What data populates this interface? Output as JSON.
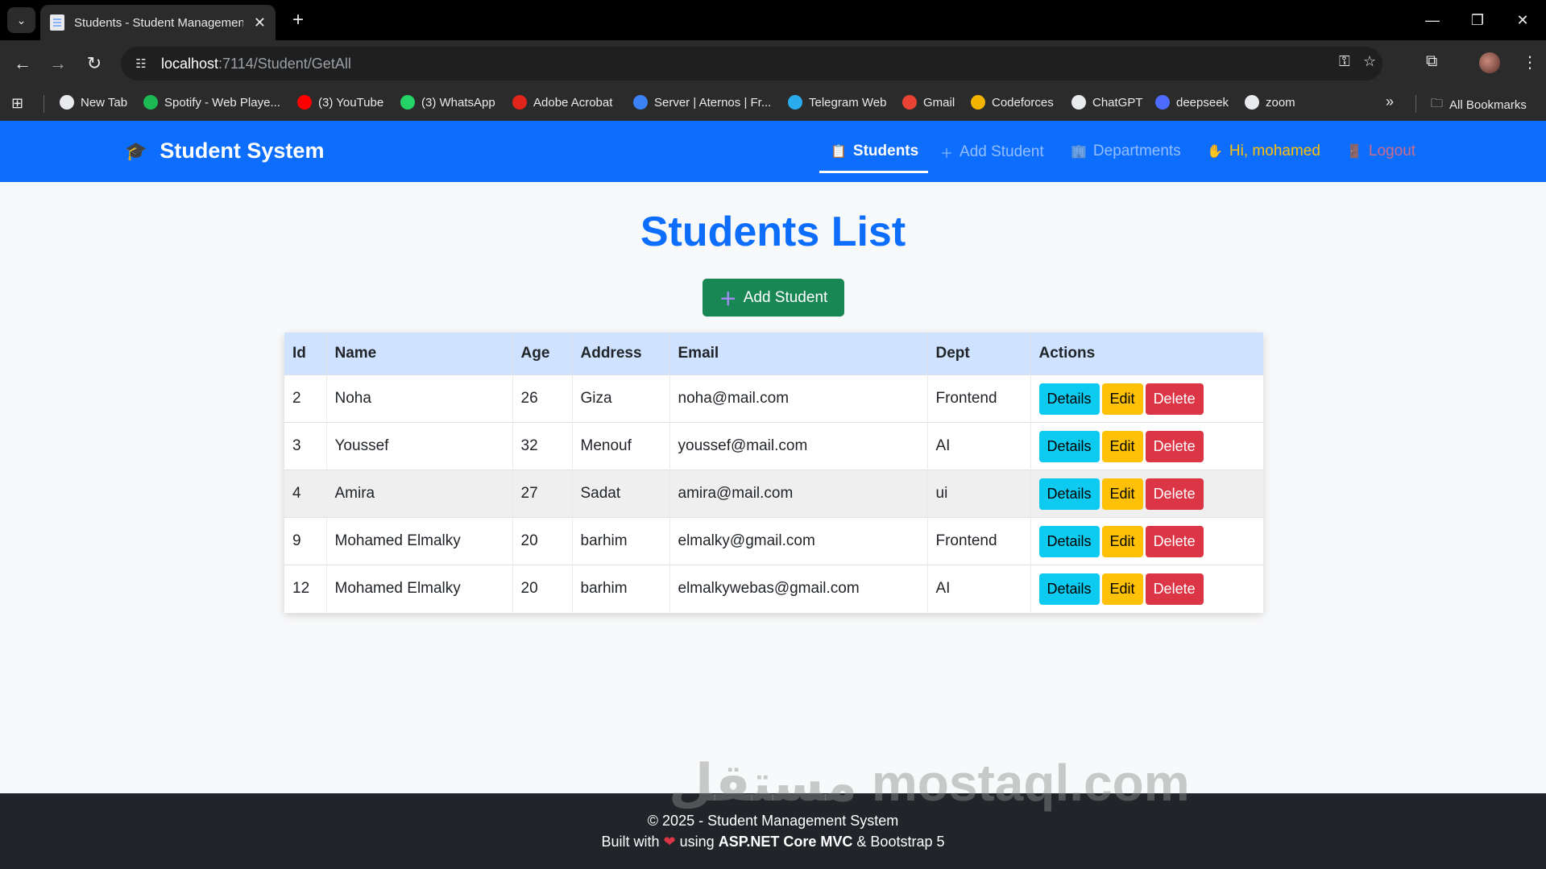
{
  "browser": {
    "tab_title": "Students - Student Managemen",
    "url_host": "localhost",
    "url_path": ":7114/Student/GetAll",
    "bookmarks": [
      {
        "label": "New Tab",
        "color": "#e8eaed"
      },
      {
        "label": "Spotify - Web Playe...",
        "color": "#1db954"
      },
      {
        "label": "(3) YouTube",
        "color": "#ff0000"
      },
      {
        "label": "(3) WhatsApp",
        "color": "#25d366"
      },
      {
        "label": "Adobe Acrobat",
        "color": "#e1251b"
      },
      {
        "label": "Server | Aternos | Fr...",
        "color": "#3b82f6"
      },
      {
        "label": "Telegram Web",
        "color": "#2aabee"
      },
      {
        "label": "Gmail",
        "color": "#ea4335"
      },
      {
        "label": "Codeforces",
        "color": "#f4b400"
      },
      {
        "label": "ChatGPT",
        "color": "#e8eaed"
      },
      {
        "label": "deepseek",
        "color": "#4d6bfe"
      },
      {
        "label": "zoom",
        "color": "#e8eaed"
      }
    ],
    "all_bookmarks": "All Bookmarks"
  },
  "navbar": {
    "brand": "Student System",
    "links": {
      "students": "Students",
      "add_student": "Add Student",
      "departments": "Departments",
      "greeting": "Hi, mohamed",
      "logout": "Logout"
    }
  },
  "main": {
    "title": "Students List",
    "add_button": "Add Student",
    "table": {
      "headers": [
        "Id",
        "Name",
        "Age",
        "Address",
        "Email",
        "Dept",
        "Actions"
      ],
      "rows": [
        {
          "id": "2",
          "name": "Noha",
          "age": "26",
          "address": "Giza",
          "email": "noha@mail.com",
          "dept": "Frontend"
        },
        {
          "id": "3",
          "name": "Youssef",
          "age": "32",
          "address": "Menouf",
          "email": "youssef@mail.com",
          "dept": "AI"
        },
        {
          "id": "4",
          "name": "Amira",
          "age": "27",
          "address": "Sadat",
          "email": "amira@mail.com",
          "dept": "ui"
        },
        {
          "id": "9",
          "name": "Mohamed Elmalky",
          "age": "20",
          "address": "barhim",
          "email": "elmalky@gmail.com",
          "dept": "Frontend"
        },
        {
          "id": "12",
          "name": "Mohamed Elmalky",
          "age": "20",
          "address": "barhim",
          "email": "elmalkywebas@gmail.com",
          "dept": "AI"
        }
      ],
      "action_labels": {
        "details": "Details",
        "edit": "Edit",
        "delete": "Delete"
      }
    }
  },
  "footer": {
    "line1": "© 2025 - Student Management System",
    "line2_prefix": "Built with",
    "line2_using": "using",
    "line2_tech": "ASP.NET Core MVC",
    "line2_suffix": "& Bootstrap 5"
  },
  "watermark": "مستقل mostaql.com",
  "colors": {
    "primary": "#0d6efd",
    "success": "#198754",
    "info": "#0dcaf0",
    "warning": "#ffc107",
    "danger": "#dc3545",
    "table_header": "#cfe2ff",
    "footer": "#212529"
  }
}
